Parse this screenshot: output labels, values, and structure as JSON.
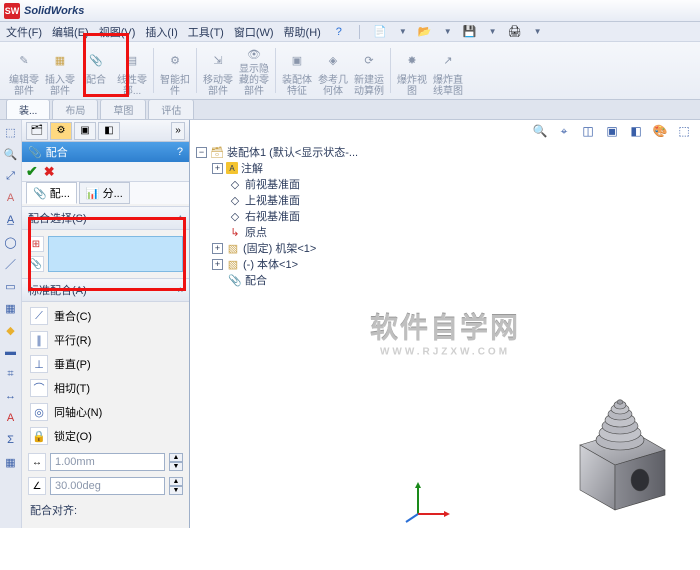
{
  "app": {
    "name": "SolidWorks"
  },
  "menu": {
    "file": "文件(F)",
    "edit": "编辑(E)",
    "view": "视图(V)",
    "insert": "插入(I)",
    "tools": "工具(T)",
    "window": "窗口(W)",
    "help": "帮助(H)"
  },
  "ribbon": {
    "edit_comp": "编辑零\n部件",
    "insert_comp": "插入零\n部件",
    "mate": "配合",
    "linear_comp": "线性零\n部...",
    "smart_fast": "智能扣\n件",
    "move_comp": "移动零\n部件",
    "show_hide": "显示隐\n藏的零\n部件",
    "asm_feat": "装配体\n特征",
    "ref_geom": "参考几\n何体",
    "new_motion": "新建运\n动算例",
    "explode": "爆炸视\n图",
    "explode_line": "爆炸直\n线草图"
  },
  "tabs": {
    "t1": "装...",
    "t2": "布局",
    "t3": "草图",
    "t4": "评估"
  },
  "pm": {
    "title": "配合",
    "help": "?",
    "tab_mate": "配...",
    "tab_analyze": "分...",
    "sec_sel": "配合选择(S)",
    "sec_std": "标准配合(A)",
    "std": {
      "coincident": "重合(C)",
      "parallel": "平行(R)",
      "perpendicular": "垂直(P)",
      "tangent": "相切(T)",
      "concentric": "同轴心(N)",
      "lock": "锁定(O)"
    },
    "dist": "1.00mm",
    "angle": "30.00deg",
    "align": "配合对齐:"
  },
  "tree": {
    "root": "装配体1 (默认<显示状态-...",
    "annotations": "注解",
    "front": "前视基准面",
    "top": "上视基准面",
    "right": "右视基准面",
    "origin": "原点",
    "part1": "(固定) 机架<1>",
    "part2": "(-) 本体<1>",
    "mates": "配合"
  },
  "watermark": {
    "l1": "软件自学网",
    "l2": "WWW.RJZXW.COM"
  }
}
